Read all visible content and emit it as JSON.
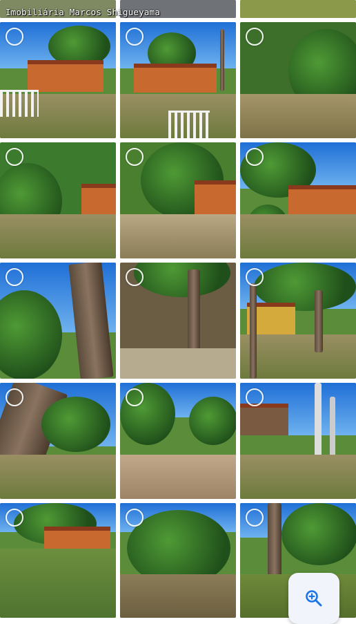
{
  "watermark": {
    "text": "Imobiliária Marcos Shigueyama"
  },
  "gallery": {
    "selection_icon": "circle-select-icon",
    "photos": [
      {
        "id": "photo-1"
      },
      {
        "id": "photo-2"
      },
      {
        "id": "photo-3"
      },
      {
        "id": "photo-4"
      },
      {
        "id": "photo-5"
      },
      {
        "id": "photo-6"
      },
      {
        "id": "photo-7"
      },
      {
        "id": "photo-8"
      },
      {
        "id": "photo-9"
      },
      {
        "id": "photo-10"
      },
      {
        "id": "photo-11"
      },
      {
        "id": "photo-12"
      },
      {
        "id": "photo-13"
      },
      {
        "id": "photo-14"
      },
      {
        "id": "photo-15"
      }
    ]
  },
  "zoom_button": {
    "icon": "zoom-in-icon",
    "color": "#1a73e8"
  }
}
